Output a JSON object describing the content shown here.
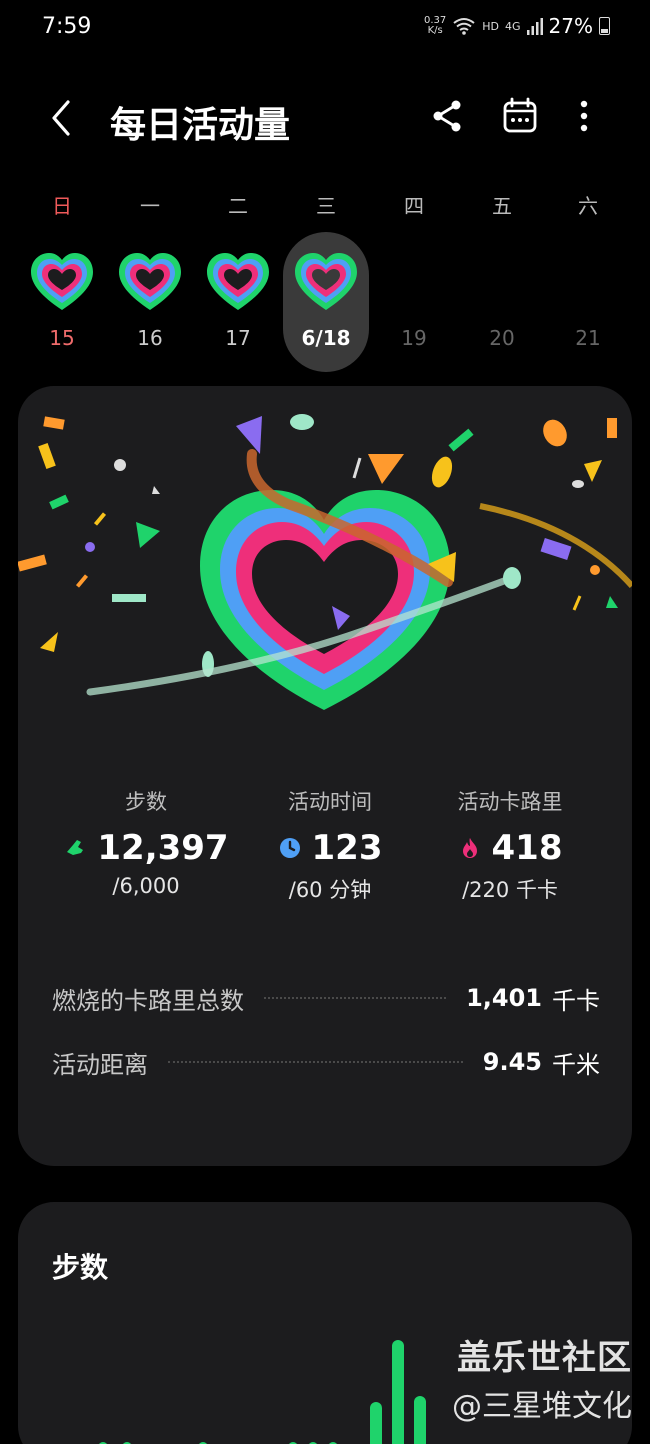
{
  "status_bar": {
    "time": "7:59",
    "speed": "0.37",
    "speed_unit": "K/s",
    "hd": "HD",
    "net": "4G",
    "battery": "27%"
  },
  "header": {
    "title": "每日活动量"
  },
  "week": [
    {
      "dow": "日",
      "date": "15",
      "ring": true
    },
    {
      "dow": "一",
      "date": "16",
      "ring": true
    },
    {
      "dow": "二",
      "date": "17",
      "ring": true
    },
    {
      "dow": "三",
      "date": "6/18",
      "ring": true,
      "selected": true
    },
    {
      "dow": "四",
      "date": "19",
      "ring": false
    },
    {
      "dow": "五",
      "date": "20",
      "ring": false
    },
    {
      "dow": "六",
      "date": "21",
      "ring": false
    }
  ],
  "stats": {
    "steps": {
      "label": "步数",
      "value": "12,397",
      "goal": "/6,000"
    },
    "active_time": {
      "label": "活动时间",
      "value": "123",
      "goal": "/60 分钟"
    },
    "calories": {
      "label": "活动卡路里",
      "value": "418",
      "goal": "/220 千卡"
    }
  },
  "summary": {
    "total_calories": {
      "label": "燃烧的卡路里总数",
      "value": "1,401",
      "unit": "千卡"
    },
    "distance": {
      "label": "活动距离",
      "value": "9.45",
      "unit": "千米"
    }
  },
  "steps_card": {
    "title": "步数"
  },
  "watermark": {
    "line1": "盖乐世社区",
    "line2": "@三星堆文化"
  },
  "colors": {
    "ring_outer": "#1fd36b",
    "ring_middle": "#4f9ff5",
    "ring_inner": "#ee2f7a",
    "accent_red": "#ef5a5a"
  }
}
